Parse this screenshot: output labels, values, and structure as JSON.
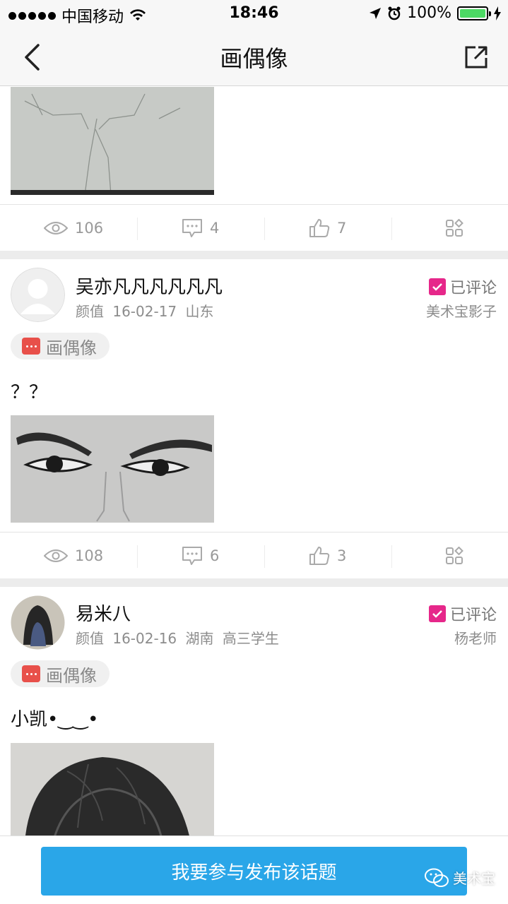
{
  "status_bar": {
    "carrier": "中国移动",
    "time": "18:46",
    "battery": "100%"
  },
  "nav": {
    "title": "画偶像"
  },
  "colors": {
    "accent": "#2aa6e8",
    "reviewed_check": "#e6278a",
    "tag_icon": "#e8504a",
    "battery": "#4cd964"
  },
  "posts": [
    {
      "stats": {
        "views": "106",
        "comments": "4",
        "likes": "7"
      }
    },
    {
      "user": "吴亦凡凡凡凡凡凡",
      "meta": "颜值 16-02-17 山东",
      "reviewed_label": "已评论",
      "reviewer": "美术宝影子",
      "tag": "画偶像",
      "text": "？？",
      "stats": {
        "views": "108",
        "comments": "6",
        "likes": "3"
      }
    },
    {
      "user": "易米八",
      "meta": "颜值 16-02-16 湖南 高三学生",
      "reviewed_label": "已评论",
      "reviewer": "杨老师",
      "tag": "画偶像",
      "text": "小凯•‿‿•"
    }
  ],
  "bottom": {
    "publish_label": "我要参与发布该话题",
    "watermark": "美术宝"
  },
  "icons": [
    "back-icon",
    "share-icon",
    "eye-icon",
    "comment-icon",
    "thumbs-up-icon",
    "grid-icon",
    "reviewed-check-icon",
    "chat-bubble-icon",
    "wechat-icon"
  ]
}
